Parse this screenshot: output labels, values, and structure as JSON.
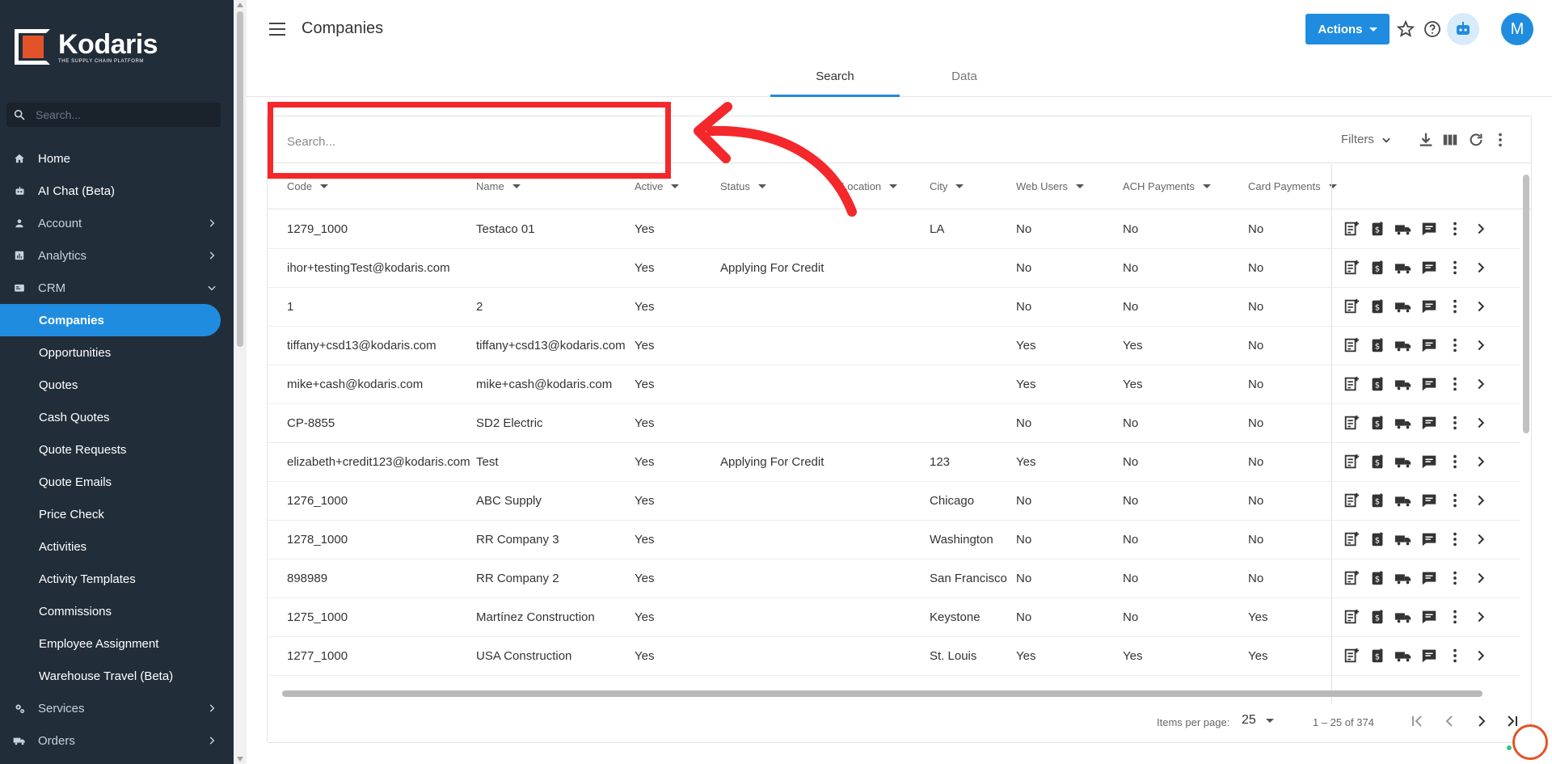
{
  "brand": {
    "name": "Kodaris",
    "tagline": "THE SUPPLY CHAIN PLATFORM",
    "accent": "#1f8ce0",
    "logo_color": "#e3532a"
  },
  "sidebar": {
    "search_placeholder": "Search...",
    "items": [
      {
        "label": "Home",
        "icon": "home-icon"
      },
      {
        "label": "AI Chat (Beta)",
        "icon": "robot-icon"
      },
      {
        "label": "Account",
        "icon": "person-icon",
        "expandable": true
      },
      {
        "label": "Analytics",
        "icon": "chart-icon",
        "expandable": true
      },
      {
        "label": "CRM",
        "icon": "crm-icon",
        "expanded": true
      }
    ],
    "crm_sub": [
      "Companies",
      "Opportunities",
      "Quotes",
      "Cash Quotes",
      "Quote Requests",
      "Quote Emails",
      "Price Check",
      "Activities",
      "Activity Templates",
      "Commissions",
      "Employee Assignment",
      "Warehouse Travel (Beta)"
    ],
    "active": "Companies",
    "bottom_items": [
      {
        "label": "Services",
        "icon": "gears-icon",
        "expandable": true
      },
      {
        "label": "Orders",
        "icon": "truck-icon",
        "expandable": true
      }
    ]
  },
  "header": {
    "title": "Companies",
    "actions_label": "Actions",
    "avatar_initial": "M"
  },
  "tabs": [
    {
      "label": "Search",
      "active": true
    },
    {
      "label": "Data",
      "active": false
    }
  ],
  "toolbar": {
    "search_placeholder": "Search...",
    "filters_label": "Filters"
  },
  "columns": [
    "Code",
    "Name",
    "Active",
    "Status",
    "Location",
    "City",
    "Web Users",
    "ACH Payments",
    "Card Payments"
  ],
  "rows": [
    {
      "code": "1279_1000",
      "name": "Testaco 01",
      "active": "Yes",
      "status": "",
      "city": "LA",
      "web": "No",
      "ach": "No",
      "card": "No"
    },
    {
      "code": "ihor+testingTest@kodaris.com",
      "name": "",
      "active": "Yes",
      "status": "Applying For Credit",
      "city": "",
      "web": "No",
      "ach": "No",
      "card": "No"
    },
    {
      "code": "1",
      "name": "2",
      "active": "Yes",
      "status": "",
      "city": "",
      "web": "No",
      "ach": "No",
      "card": "No"
    },
    {
      "code": "tiffany+csd13@kodaris.com",
      "name": "tiffany+csd13@kodaris.com",
      "active": "Yes",
      "status": "",
      "city": "",
      "web": "Yes",
      "ach": "Yes",
      "card": "No"
    },
    {
      "code": "mike+cash@kodaris.com",
      "name": "mike+cash@kodaris.com",
      "active": "Yes",
      "status": "",
      "city": "",
      "web": "Yes",
      "ach": "Yes",
      "card": "No"
    },
    {
      "code": "CP-8855",
      "name": "SD2 Electric",
      "active": "Yes",
      "status": "",
      "city": "",
      "web": "No",
      "ach": "No",
      "card": "No"
    },
    {
      "code": "elizabeth+credit123@kodaris.com",
      "name": "Test",
      "active": "Yes",
      "status": "Applying For Credit",
      "city": "123",
      "web": "Yes",
      "ach": "No",
      "card": "No"
    },
    {
      "code": "1276_1000",
      "name": "ABC Supply",
      "active": "Yes",
      "status": "",
      "city": "Chicago",
      "web": "No",
      "ach": "No",
      "card": "No"
    },
    {
      "code": "1278_1000",
      "name": "RR Company 3",
      "active": "Yes",
      "status": "",
      "city": "Washington",
      "web": "No",
      "ach": "No",
      "card": "No"
    },
    {
      "code": "898989",
      "name": "RR Company 2",
      "active": "Yes",
      "status": "",
      "city": "San Francisco",
      "web": "No",
      "ach": "No",
      "card": "No"
    },
    {
      "code": "1275_1000",
      "name": "Martínez Construction",
      "active": "Yes",
      "status": "",
      "city": "Keystone",
      "web": "No",
      "ach": "No",
      "card": "Yes"
    },
    {
      "code": "1277_1000",
      "name": "USA Construction",
      "active": "Yes",
      "status": "",
      "city": "St. Louis",
      "web": "Yes",
      "ach": "Yes",
      "card": "Yes"
    }
  ],
  "paginator": {
    "items_per_page_label": "Items per page:",
    "page_size": "25",
    "range": "1 – 25 of 374"
  },
  "annotation_color": "#f4272a"
}
